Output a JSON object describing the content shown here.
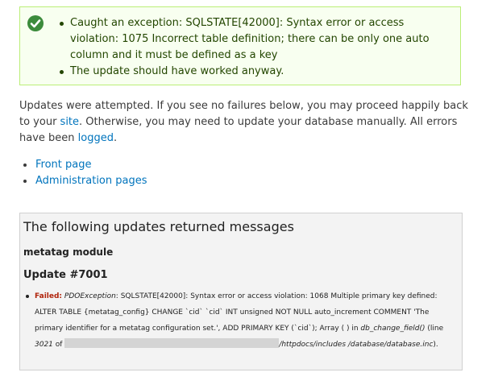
{
  "status": {
    "icon": "checkmark-icon",
    "items": [
      "Caught an exception: SQLSTATE[42000]: Syntax error or access violation: 1075 Incorrect table definition; there can be only one auto column and it must be defined as a key",
      "The update should have worked anyway."
    ]
  },
  "intro": {
    "part1": "Updates were attempted. If you see no failures below, you may proceed happily back to your ",
    "site_link": "site",
    "part2": ". Otherwise, you may need to update your database manually. All errors have been ",
    "logged_link": "logged",
    "part3": "."
  },
  "links": [
    "Front page",
    "Administration pages"
  ],
  "messages": {
    "title": "The following updates returned messages",
    "module": "metatag module",
    "update": "Update #7001",
    "error": {
      "label": "Failed:",
      "exception": "PDOException",
      "text1": ": SQLSTATE[42000]: Syntax error or access violation: 1068 Multiple primary key defined: ALTER TABLE {metatag_config} CHANGE `cid` `cid` INT unsigned NOT NULL auto_increment COMMENT 'The primary identifier for a metatag configuration set.', ADD PRIMARY KEY (`cid`); Array ( ) in ",
      "function": "db_change_field()",
      "text2": " (line ",
      "line": "3021",
      "text3": " of ",
      "path": "/httpdocs/includes /database/database.inc",
      "text4": ")."
    }
  },
  "colors": {
    "status_bg": "#f8fff0",
    "status_border": "#bbee77",
    "status_text": "#234600",
    "link": "#0074bd",
    "failed": "#b0230b",
    "panel_bg": "#f3f3f3"
  }
}
